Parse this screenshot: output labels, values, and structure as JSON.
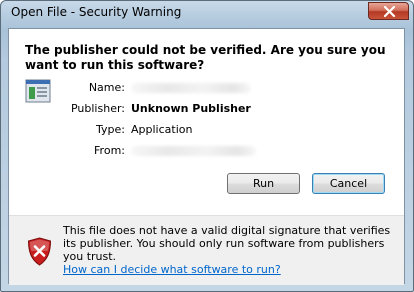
{
  "window": {
    "title": "Open File - Security Warning"
  },
  "dialog": {
    "headline": "The publisher could not be verified.  Are you sure you want to run this software?",
    "fields": {
      "name_label": "Name:",
      "publisher_label": "Publisher:",
      "publisher_value": "Unknown Publisher",
      "type_label": "Type:",
      "type_value": "Application",
      "from_label": "From:"
    },
    "buttons": {
      "run": "Run",
      "cancel": "Cancel"
    },
    "footer": {
      "message": "This file does not have a valid digital signature that verifies its publisher.  You should only run software from publishers you trust.",
      "link": "How can I decide what software to run?"
    }
  },
  "icons": {
    "close": "close-icon",
    "app": "application-icon",
    "shield": "security-shield-error-icon"
  },
  "colors": {
    "link": "#0066cc",
    "close_button": "#c9533a",
    "shield_red": "#c81e1e"
  }
}
